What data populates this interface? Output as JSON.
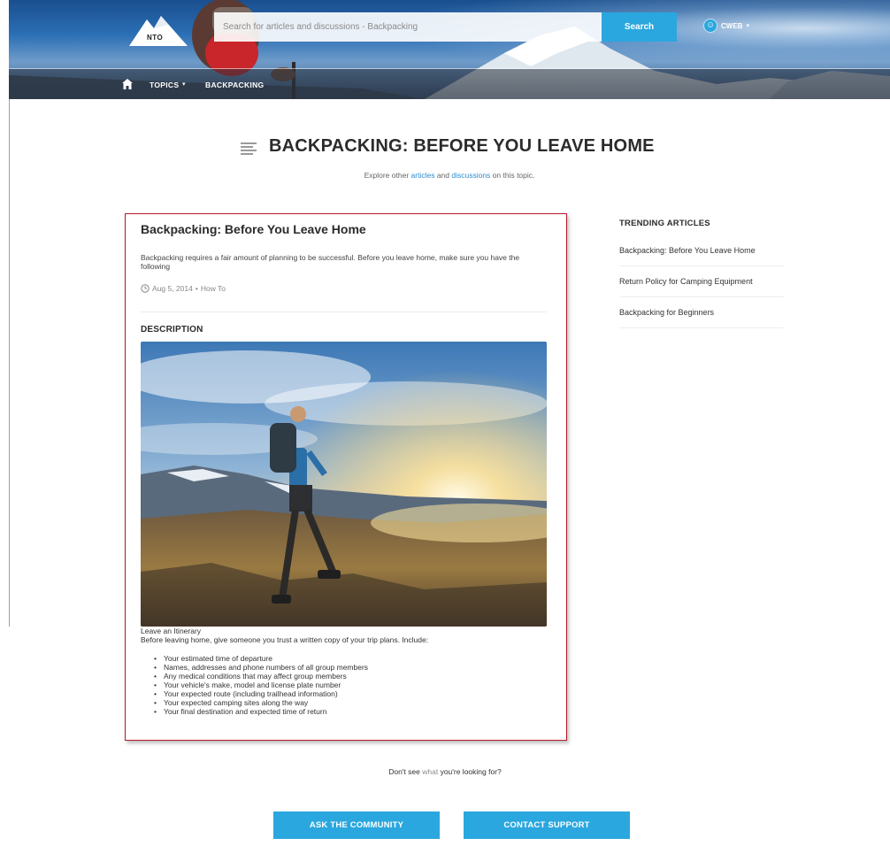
{
  "header": {
    "logo_text": "NTO",
    "search": {
      "placeholder": "Search for articles and discussions - Backpacking",
      "button_label": "Search"
    },
    "user": {
      "name": "CWEB",
      "caret": "▾"
    },
    "nav": {
      "topics_label": "TOPICS",
      "topics_caret": "▾",
      "current_topic": "BACKPACKING"
    }
  },
  "topic": {
    "title": "BACKPACKING: BEFORE YOU LEAVE HOME",
    "subtitle_prefix": "Explore other ",
    "subtitle_link1": "articles",
    "subtitle_mid": " and ",
    "subtitle_link2": "discussions",
    "subtitle_suffix": " on this topic."
  },
  "article": {
    "title": "Backpacking: Before You Leave Home",
    "summary": "Backpacking requires a fair amount of planning to be successful. Before you leave home, make sure you have the following",
    "date": "Aug 5, 2014",
    "separator": "•",
    "type": "How To",
    "description_heading": "DESCRIPTION",
    "body_heading": "Leave an Itinerary",
    "body_intro": "Before leaving home, give someone you trust a written copy of your trip plans. Include:",
    "checklist": [
      "Your estimated time of departure",
      "Names, addresses and phone numbers of all group members",
      "Any medical conditions that may affect group members",
      "Your vehicle's make, model and license plate number",
      "Your expected route (including trailhead information)",
      "Your expected camping sites along the way",
      "Your final destination and expected time of return"
    ]
  },
  "sidebar": {
    "heading": "TRENDING ARTICLES",
    "items": [
      "Backpacking: Before You Leave Home",
      "Return Policy for Camping Equipment",
      "Backpacking for Beginners"
    ]
  },
  "footer": {
    "question_prefix": "Don't see ",
    "question_accent": "what",
    "question_suffix": " you're looking for?",
    "ask_label": "ASK THE COMMUNITY",
    "contact_label": "CONTACT SUPPORT"
  },
  "colors": {
    "accent": "#2aa7de",
    "link": "#2a8ed1",
    "highlight_border": "#b3182a"
  },
  "icons": [
    "nto-logo-icon",
    "user-avatar-icon",
    "home-icon",
    "topic-list-icon",
    "clock-icon"
  ]
}
